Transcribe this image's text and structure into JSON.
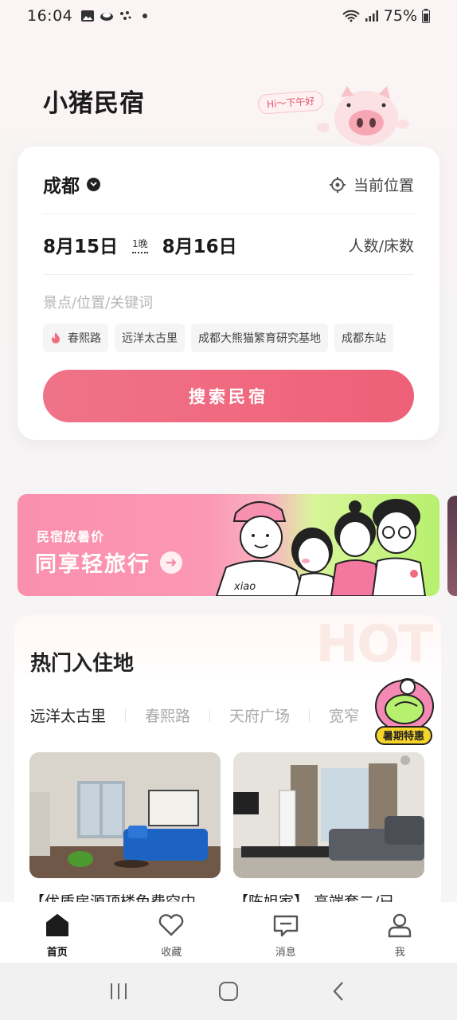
{
  "status_bar": {
    "time": "16:04",
    "battery": "75%",
    "icons": [
      "gallery-icon",
      "weather-icon",
      "assistant-icon",
      "dot-icon",
      "wifi-icon",
      "signal-icon",
      "battery-icon"
    ]
  },
  "header": {
    "app_title": "小猪民宿",
    "greeting": "Hi～下午好"
  },
  "search": {
    "city": "成都",
    "current_location": "当前位置",
    "check_in": "8月15日",
    "nights": "1晚",
    "check_out": "8月16日",
    "guests": "人数/床数",
    "keyword_placeholder": "景点/位置/关键词",
    "tags": [
      "春熙路",
      "远洋太古里",
      "成都大熊猫繁育研究基地",
      "成都东站"
    ],
    "button": "搜索民宿"
  },
  "banner": {
    "subtitle": "民宿放暑价",
    "title": "同享轻旅行",
    "art_text": "xiao"
  },
  "hot": {
    "bg_text": "HOT",
    "title": "热门入住地",
    "tabs": [
      "远洋太古里",
      "春熙路",
      "天府广场",
      "宽窄"
    ],
    "active_tab": 0,
    "promo_badge": "暑期特惠",
    "listings": [
      {
        "title": "【优质房源顶楼免费空中"
      },
      {
        "title": "【陈姐家】 高端套二/已"
      }
    ]
  },
  "bottom_nav": {
    "items": [
      {
        "label": "首页",
        "icon": "home-icon"
      },
      {
        "label": "收藏",
        "icon": "heart-icon"
      },
      {
        "label": "消息",
        "icon": "message-icon"
      },
      {
        "label": "我",
        "icon": "user-icon"
      }
    ],
    "active": 0
  },
  "colors": {
    "accent": "#f06a80",
    "accent_light": "#fb98b4",
    "text_primary": "#1b1b1b",
    "text_muted": "#b5b5b5"
  }
}
